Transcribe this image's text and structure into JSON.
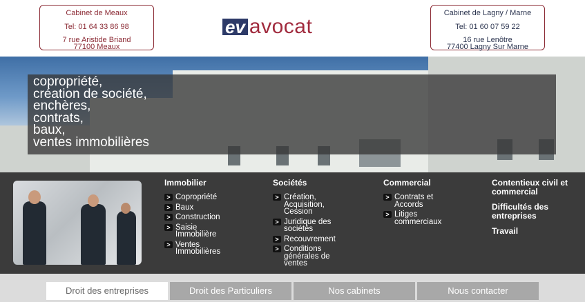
{
  "header": {
    "office_meaux": {
      "title": "Cabinet de Meaux",
      "phone": "Tel: 01 64 33 86 98",
      "address1": "7 rue Aristide Briand",
      "address2": "77100 Meaux"
    },
    "office_lagny": {
      "title": "Cabinet de Lagny / Marne",
      "phone": "Tel: 01 60 07 59 22",
      "address1": "16 rue Lenôtre",
      "address2": "77400 Lagny Sur Marne"
    },
    "logo_ev": "ev",
    "logo_avocat": "avocat"
  },
  "hero": {
    "lines": [
      "copropriété,",
      "création de société,",
      "enchères,",
      "contrats,",
      "baux,",
      "ventes immobilières"
    ]
  },
  "nav": {
    "bullet": ">",
    "immobilier": {
      "title": "Immobilier",
      "items": [
        "Copropriété",
        "Baux",
        "Construction",
        "Saisie Immobilière",
        "Ventes Immobilières"
      ]
    },
    "societes": {
      "title": "Sociétés",
      "items": [
        "Création, Acquisition, Cession",
        "Juridique des sociétés",
        "Recouvrement",
        "Conditions générales de ventes"
      ]
    },
    "commercial": {
      "title": "Commercial",
      "items": [
        "Contrats et Accords",
        "Litiges commerciaux"
      ]
    },
    "civil": {
      "items": [
        "Contentieux civil et commercial",
        "Difficultés des entreprises",
        "Travail"
      ]
    }
  },
  "tabs": [
    {
      "label": "Droit des entreprises",
      "active": true
    },
    {
      "label": "Droit des Particuliers",
      "active": false
    },
    {
      "label": "Nos cabinets",
      "active": false
    },
    {
      "label": "Nous contacter",
      "active": false
    }
  ],
  "colors": {
    "brand_blue": "#2d3a68",
    "brand_red": "#a12b3e",
    "nav_bg": "#3b3b3b",
    "tab_bg": "#a8a8a8"
  }
}
